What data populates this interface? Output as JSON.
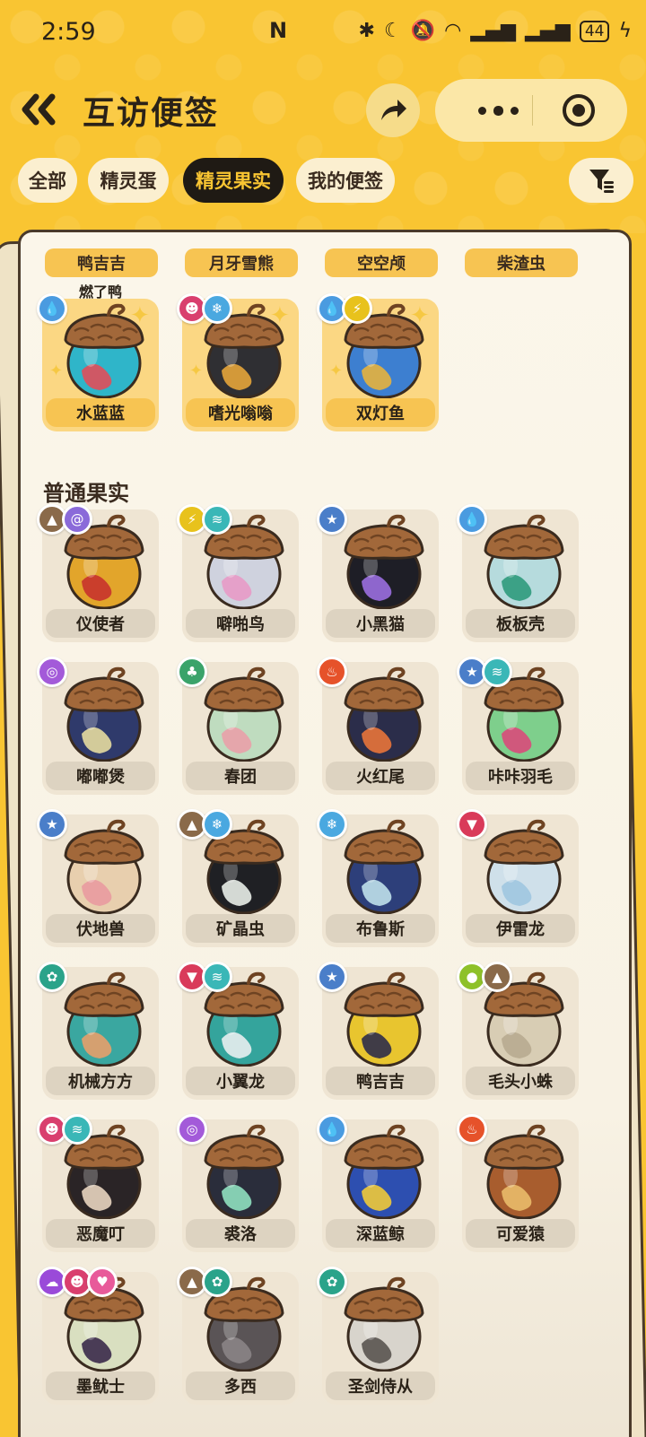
{
  "status": {
    "time": "2:59",
    "battery": "44"
  },
  "header": {
    "title": "互访便签"
  },
  "tabs": [
    {
      "label": "全部",
      "active": false
    },
    {
      "label": "精灵蛋",
      "active": false
    },
    {
      "label": "精灵果实",
      "active": true
    },
    {
      "label": "我的便签",
      "active": false
    }
  ],
  "partial_row": [
    "鸭吉吉",
    "月牙雪熊",
    "空空颅",
    "柴渣虫"
  ],
  "partial_caption": "燃了鸭",
  "special_cards": [
    {
      "name": "水蓝蓝",
      "badges": [
        "water"
      ],
      "colors": [
        "#2fb5c9",
        "#e14e5a"
      ]
    },
    {
      "name": "嗜光嗡嗡",
      "badges": [
        "demon",
        "ice"
      ],
      "colors": [
        "#2f2f33",
        "#e6a53a"
      ]
    },
    {
      "name": "双灯鱼",
      "badges": [
        "water",
        "electric"
      ],
      "colors": [
        "#3d7fd0",
        "#e5b23d"
      ]
    }
  ],
  "section_title": "普通果实",
  "normal_cards": [
    {
      "name": "仪使者",
      "badges": [
        "ground",
        "psychic"
      ],
      "colors": [
        "#e2a52b",
        "#c8332c"
      ]
    },
    {
      "name": "噼啪鸟",
      "badges": [
        "electric",
        "wing"
      ],
      "colors": [
        "#cfd2de",
        "#e79ac7"
      ]
    },
    {
      "name": "小黑猫",
      "badges": [
        "star"
      ],
      "colors": [
        "#1e1e26",
        "#9a6ee0"
      ]
    },
    {
      "name": "板板壳",
      "badges": [
        "water"
      ],
      "colors": [
        "#b6dbdd",
        "#2f9a7c"
      ]
    },
    {
      "name": "嘟嘟煲",
      "badges": [
        "poison"
      ],
      "colors": [
        "#2f3a6b",
        "#e6dca0"
      ]
    },
    {
      "name": "春团",
      "badges": [
        "grass"
      ],
      "colors": [
        "#bfdcbf",
        "#e9a0a8"
      ]
    },
    {
      "name": "火红尾",
      "badges": [
        "fire"
      ],
      "colors": [
        "#2b2d4a",
        "#e8743a"
      ]
    },
    {
      "name": "咔咔羽毛",
      "badges": [
        "star",
        "wing"
      ],
      "colors": [
        "#7ecf8c",
        "#d94a7a"
      ]
    },
    {
      "name": "伏地兽",
      "badges": [
        "star"
      ],
      "colors": [
        "#e8cfae",
        "#e99aa0"
      ]
    },
    {
      "name": "矿晶虫",
      "badges": [
        "ground",
        "ice"
      ],
      "colors": [
        "#1f2024",
        "#e8ede8"
      ]
    },
    {
      "name": "布鲁斯",
      "badges": [
        "ice"
      ],
      "colors": [
        "#2d3f7a",
        "#bfe0ea"
      ]
    },
    {
      "name": "伊雷龙",
      "badges": [
        "dragon"
      ],
      "colors": [
        "#cfe0ea",
        "#9ec7e0"
      ]
    },
    {
      "name": "机械方方",
      "badges": [
        "mech"
      ],
      "colors": [
        "#3aa7a0",
        "#e7a06a"
      ]
    },
    {
      "name": "小翼龙",
      "badges": [
        "dragon",
        "wing"
      ],
      "colors": [
        "#34a49c",
        "#e8eef0"
      ]
    },
    {
      "name": "鸭吉吉",
      "badges": [
        "star"
      ],
      "colors": [
        "#e8c52f",
        "#2d2c4a"
      ]
    },
    {
      "name": "毛头小蛛",
      "badges": [
        "bug",
        "ground"
      ],
      "colors": [
        "#d8cdb4",
        "#b8ab90"
      ]
    },
    {
      "name": "恶魔叮",
      "badges": [
        "demon",
        "wing"
      ],
      "colors": [
        "#2a2426",
        "#e8d5c0"
      ]
    },
    {
      "name": "裘洛",
      "badges": [
        "poison"
      ],
      "colors": [
        "#2a2d3b",
        "#8fe0c0"
      ]
    },
    {
      "name": "深蓝鲸",
      "badges": [
        "water"
      ],
      "colors": [
        "#2d4fb0",
        "#f0c93a"
      ]
    },
    {
      "name": "可爱猿",
      "badges": [
        "fire"
      ],
      "colors": [
        "#a85d2e",
        "#e9bb6a"
      ]
    },
    {
      "name": "墨鱿士",
      "badges": [
        "ghost",
        "demon",
        "fairy"
      ],
      "colors": [
        "#d9dfc0",
        "#3a2a4a"
      ]
    },
    {
      "name": "多西",
      "badges": [
        "ground",
        "mech"
      ],
      "colors": [
        "#5a5456",
        "#8a8486"
      ]
    },
    {
      "name": "圣剑侍从",
      "badges": [
        "mech"
      ],
      "colors": [
        "#d8d4cc",
        "#5a5450"
      ]
    }
  ],
  "badge_colors": {
    "water": "#4a9be0",
    "ice": "#4aa8e0",
    "electric": "#e8c21c",
    "demon": "#d93f6e",
    "ground": "#8a6a4a",
    "psychic": "#8a6ad9",
    "wing": "#3ab7b7",
    "star": "#4a7ec9",
    "poison": "#a35ad9",
    "grass": "#3aa36a",
    "fire": "#e6522a",
    "dragon": "#d93a5a",
    "mech": "#2aa38a",
    "bug": "#8ec12a",
    "ghost": "#9a4ad9",
    "fairy": "#e85a9a"
  },
  "badge_glyphs": {
    "water": "💧",
    "ice": "❄",
    "electric": "⚡",
    "demon": "☻",
    "ground": "▲",
    "psychic": "@",
    "wing": "≋",
    "star": "★",
    "poison": "◎",
    "grass": "♣",
    "fire": "♨",
    "dragon": "▼",
    "mech": "✿",
    "bug": "●",
    "ghost": "☁",
    "fairy": "♥"
  }
}
